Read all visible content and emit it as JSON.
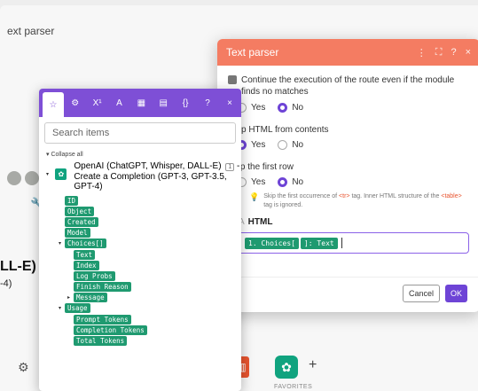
{
  "scenario": {
    "title_fragment": "ext parser",
    "bg_big_text": "LL-E)",
    "bg_small_text": "-4)",
    "favorites_label": "FAVORITES"
  },
  "dialog": {
    "title": "Text parser",
    "header_icons": [
      "more-icon",
      "expand-icon",
      "help-icon",
      "close-icon"
    ],
    "continue_label": "Continue the execution of the route even if the module finds no matches",
    "continue_options": {
      "yes": "Yes",
      "no": "No",
      "selected": "No"
    },
    "strip_label": "Strip HTML from contents",
    "strip_options": {
      "yes": "Yes",
      "no": "No",
      "selected": "Yes"
    },
    "skip_label": "Skip the first row",
    "skip_options": {
      "yes": "Yes",
      "no": "No",
      "selected": "No"
    },
    "hint": {
      "part1": "Skip the first occurrence of",
      "tag1": "<tr>",
      "part2": "tag. Inner HTML structure of the",
      "tag2": "<table>",
      "part3": "tag is ignored."
    },
    "html_label": "HTML",
    "html_value_pills": [
      "1. Choices[",
      "]: Text"
    ],
    "cancel_label": "Cancel",
    "ok_label": "OK",
    "accent": "#6e44d6",
    "header_color": "#f47c62"
  },
  "mapper": {
    "tabs": [
      "star-icon",
      "gear-icon",
      "X¹",
      "A",
      "calendar-icon",
      "table-icon",
      "{}",
      "?",
      "×"
    ],
    "search_placeholder": "Search items",
    "collapse_all": "Collapse all",
    "module_name": "OpenAI (ChatGPT, Whisper, DALL-E)",
    "module_badge": "1",
    "module_sub": "Create a Completion (GPT-3, GPT-3.5, GPT-4)",
    "items": [
      {
        "label": "ID",
        "level": 0,
        "expander": ""
      },
      {
        "label": "Object",
        "level": 0,
        "expander": ""
      },
      {
        "label": "Created",
        "level": 0,
        "expander": ""
      },
      {
        "label": "Model",
        "level": 0,
        "expander": ""
      },
      {
        "label": "Choices[]",
        "level": 0,
        "expander": "open"
      },
      {
        "label": "Text",
        "level": 1,
        "expander": ""
      },
      {
        "label": "Index",
        "level": 1,
        "expander": ""
      },
      {
        "label": "Log Probs",
        "level": 1,
        "expander": ""
      },
      {
        "label": "Finish Reason",
        "level": 1,
        "expander": ""
      },
      {
        "label": "Message",
        "level": 1,
        "expander": "closed"
      },
      {
        "label": "Usage",
        "level": 0,
        "expander": "open"
      },
      {
        "label": "Prompt Tokens",
        "level": 1,
        "expander": ""
      },
      {
        "label": "Completion Tokens",
        "level": 1,
        "expander": ""
      },
      {
        "label": "Total Tokens",
        "level": 1,
        "expander": ""
      }
    ]
  }
}
